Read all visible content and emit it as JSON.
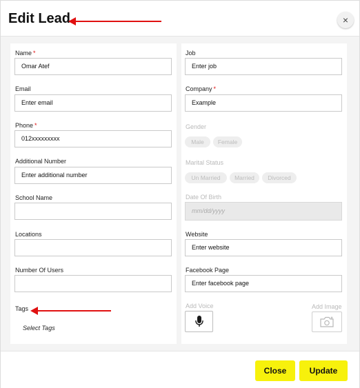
{
  "modal": {
    "title": "Edit Lead",
    "close_symbol": "×"
  },
  "left": {
    "name": {
      "label": "Name",
      "required": "*",
      "value": "Omar Atef"
    },
    "email": {
      "label": "Email",
      "placeholder": "Enter email"
    },
    "phone": {
      "label": "Phone",
      "required": "*",
      "value": "012xxxxxxxxx"
    },
    "additional_number": {
      "label": "Additional Number",
      "placeholder": "Enter additional number"
    },
    "school_name": {
      "label": "School Name",
      "value": ""
    },
    "locations": {
      "label": "Locations",
      "value": ""
    },
    "number_of_users": {
      "label": "Number Of Users",
      "value": ""
    },
    "tags": {
      "label": "Tags",
      "placeholder": "Select Tags"
    }
  },
  "right": {
    "job": {
      "label": "Job",
      "placeholder": "Enter job"
    },
    "company": {
      "label": "Company",
      "required": "*",
      "value": "Example"
    },
    "gender": {
      "label": "Gender",
      "options": [
        "Male",
        "Female"
      ]
    },
    "marital_status": {
      "label": "Marital Status",
      "options": [
        "Un Married",
        "Married",
        "Divorced"
      ]
    },
    "date_of_birth": {
      "label": "Date Of Birth",
      "placeholder": "mm/dd/yyyy"
    },
    "website": {
      "label": "Website",
      "placeholder": "Enter website"
    },
    "facebook_page": {
      "label": "Facebook Page",
      "placeholder": "Enter facebook page"
    },
    "add_voice": {
      "label": "Add Voice",
      "icon": "microphone-icon"
    },
    "add_image": {
      "label": "Add Image",
      "icon": "camera-icon"
    }
  },
  "footer": {
    "close_label": "Close",
    "update_label": "Update"
  },
  "colors": {
    "accent_button": "#f7f10c",
    "required_mark": "#e01010",
    "annotation_arrow": "#e01010"
  }
}
